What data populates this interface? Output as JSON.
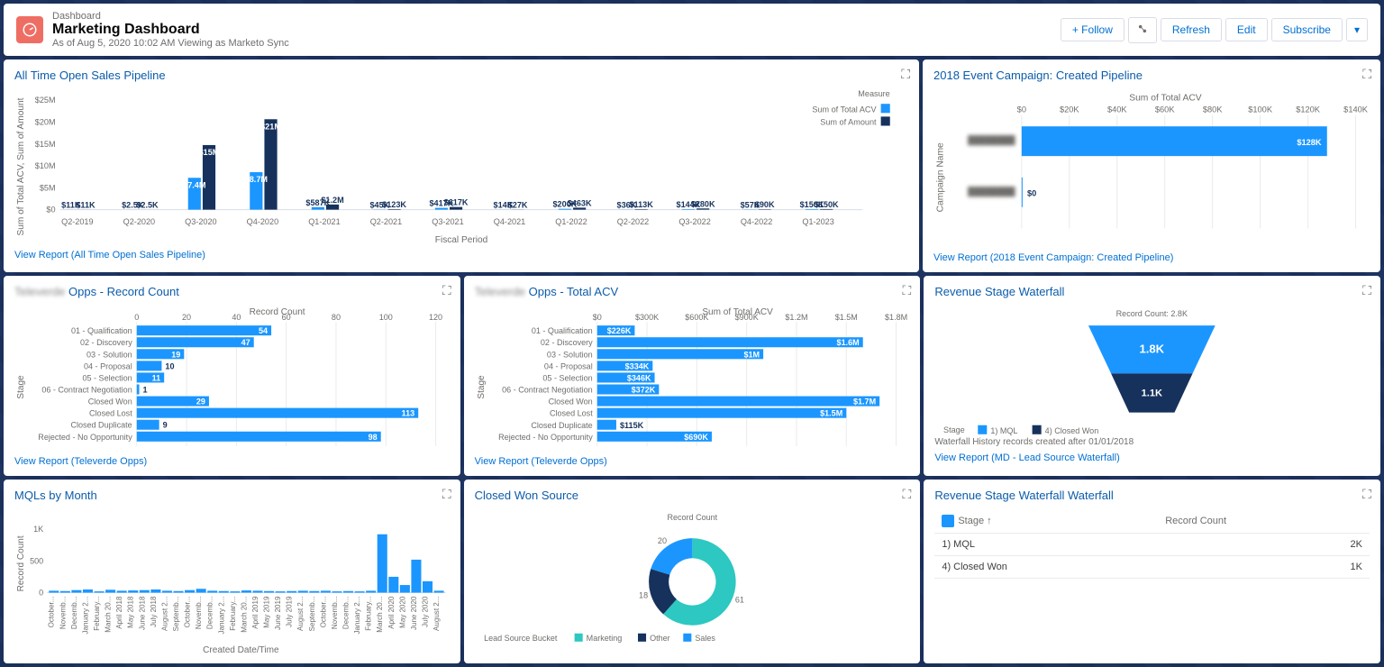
{
  "header": {
    "breadcrumb": "Dashboard",
    "title": "Marketing Dashboard",
    "subtitle": "As of Aug 5, 2020 10:02 AM Viewing as Marketo Sync",
    "follow": "+ Follow",
    "refresh": "Refresh",
    "edit": "Edit",
    "subscribe": "Subscribe"
  },
  "cards": {
    "pipeline": {
      "title": "All Time Open Sales Pipeline",
      "link": "View Report (All Time Open Sales Pipeline)",
      "legend_title": "Measure",
      "legend1": "Sum of Total ACV",
      "legend2": "Sum of Amount",
      "xlabel": "Fiscal Period",
      "ylabel": "Sum of Total ACV, Sum of Amount"
    },
    "event": {
      "title": "2018 Event Campaign: Created Pipeline",
      "link": "View Report (2018 Event Campaign: Created Pipeline)",
      "xlabel": "Sum of Total ACV",
      "ylabel": "Campaign Name"
    },
    "oppsCount": {
      "title": "Opps - Record Count",
      "title_prefix": "Telev...",
      "link": "View Report (Televerde Opps)",
      "xlabel": "Record Count",
      "ylabel": "Stage"
    },
    "oppsAcv": {
      "title": "Opps - Total ACV",
      "link": "View Report (Televerde Opps)",
      "xlabel": "Sum of Total ACV",
      "ylabel": "Stage"
    },
    "waterfall": {
      "title": "Revenue Stage Waterfall",
      "count_label": "Record Count: 2.8K",
      "note": "Waterfall History records created after 01/01/2018",
      "link": "View Report (MD - Lead Source Waterfall)",
      "stage_label": "Stage",
      "l1": "1) MQL",
      "l2": "4) Closed Won"
    },
    "mql": {
      "title": "MQLs by Month",
      "xlabel": "Created Date/Time",
      "ylabel": "Record Count"
    },
    "closedWon": {
      "title": "Closed Won Source",
      "center": "Record Count",
      "legend_label": "Lead Source Bucket",
      "l1": "Marketing",
      "l2": "Other",
      "l3": "Sales"
    },
    "waterfallTable": {
      "title": "Revenue Stage Waterfall Waterfall",
      "col1": "Stage",
      "col2": "Record Count",
      "r1": "1) MQL",
      "r1v": "2K",
      "r2": "4) Closed Won",
      "r2v": "1K"
    }
  },
  "chart_data": [
    {
      "id": "pipeline",
      "type": "bar",
      "title": "All Time Open Sales Pipeline",
      "xlabel": "Fiscal Period",
      "ylabel": "Sum of Total ACV, Sum of Amount",
      "ylim": [
        0,
        25000000
      ],
      "categories": [
        "Q2-2019",
        "Q2-2020",
        "Q3-2020",
        "Q4-2020",
        "Q1-2021",
        "Q2-2021",
        "Q3-2021",
        "Q4-2021",
        "Q1-2022",
        "Q2-2022",
        "Q3-2022",
        "Q4-2022",
        "Q1-2023"
      ],
      "series": [
        {
          "name": "Sum of Total ACV",
          "values": [
            11000,
            2500,
            7400000,
            8700000,
            587000,
            45000,
            417000,
            14000,
            200000,
            36000,
            144000,
            57000,
            150000
          ],
          "labels": [
            "$11K",
            "$2.5K",
            "$7.4M",
            "$8.7M",
            "$587K",
            "$45K",
            "$417K",
            "$14K",
            "$200K",
            "$36K",
            "$144K",
            "$57K",
            "$150K"
          ]
        },
        {
          "name": "Sum of Amount",
          "values": [
            11000,
            2500,
            15000000,
            21000000,
            1200000,
            123000,
            617000,
            27000,
            463000,
            113000,
            280000,
            90000,
            150000
          ],
          "labels": [
            "$11K",
            "$2.5K",
            "$15M",
            "$21M",
            "$1.2M",
            "$123K",
            "$617K",
            "$27K",
            "$463K",
            "$113K",
            "$280K",
            "$90K",
            "$150K"
          ]
        }
      ]
    },
    {
      "id": "event",
      "type": "bar",
      "orientation": "horizontal",
      "title": "2018 Event Campaign: Created Pipeline",
      "xlabel": "Sum of Total ACV",
      "ylabel": "Campaign Name",
      "xlim": [
        0,
        140000
      ],
      "xticks": [
        "$0",
        "$20K",
        "$40K",
        "$60K",
        "$80K",
        "$100K",
        "$120K",
        "$140K"
      ],
      "categories": [
        "(redacted campaign 1)",
        "(redacted campaign 2)"
      ],
      "values": [
        128000,
        0
      ],
      "labels": [
        "$128K",
        "$0"
      ]
    },
    {
      "id": "oppsCount",
      "type": "bar",
      "orientation": "horizontal",
      "title": "Opps - Record Count",
      "xlabel": "Record Count",
      "xlim": [
        0,
        120
      ],
      "xticks": [
        0,
        20,
        40,
        60,
        80,
        100,
        120
      ],
      "categories": [
        "01 - Qualification",
        "02 - Discovery",
        "03 - Solution",
        "04 - Proposal",
        "05 - Selection",
        "06 - Contract Negotiation",
        "Closed Won",
        "Closed Lost",
        "Closed Duplicate",
        "Rejected - No Opportunity"
      ],
      "values": [
        54,
        47,
        19,
        10,
        11,
        1,
        29,
        113,
        9,
        98
      ]
    },
    {
      "id": "oppsAcv",
      "type": "bar",
      "orientation": "horizontal",
      "title": "Opps - Total ACV",
      "xlabel": "Sum of Total ACV",
      "xlim": [
        0,
        1800000
      ],
      "xticks": [
        "$0",
        "$300K",
        "$600K",
        "$900K",
        "$1.2M",
        "$1.5M",
        "$1.8M"
      ],
      "categories": [
        "01 - Qualification",
        "02 - Discovery",
        "03 - Solution",
        "04 - Proposal",
        "05 - Selection",
        "06 - Contract Negotiation",
        "Closed Won",
        "Closed Lost",
        "Closed Duplicate",
        "Rejected - No Opportunity"
      ],
      "values": [
        226000,
        1600000,
        1000000,
        334000,
        346000,
        372000,
        1700000,
        1500000,
        115000,
        690000
      ],
      "labels": [
        "$226K",
        "$1.6M",
        "$1M",
        "$334K",
        "$346K",
        "$372K",
        "$1.7M",
        "$1.5M",
        "$115K",
        "$690K"
      ]
    },
    {
      "id": "waterfallFunnel",
      "type": "funnel",
      "title": "Revenue Stage Waterfall",
      "total": 2800,
      "stages": [
        {
          "name": "1) MQL",
          "value": 1800,
          "label": "1.8K"
        },
        {
          "name": "4) Closed Won",
          "value": 1100,
          "label": "1.1K"
        }
      ]
    },
    {
      "id": "mql",
      "type": "bar",
      "title": "MQLs by Month",
      "xlabel": "Created Date/Time",
      "ylabel": "Record Count",
      "ylim": [
        0,
        1000
      ],
      "yticks": [
        0,
        500,
        "1K"
      ],
      "categories": [
        "October...",
        "Novemb...",
        "Decemb...",
        "January 2...",
        "February...",
        "March 20...",
        "April 2018",
        "May 2018",
        "June 2018",
        "July 2018",
        "August 2...",
        "Septemb...",
        "October...",
        "Novemb...",
        "Decemb...",
        "January 2...",
        "February...",
        "March 20...",
        "April 2019",
        "May 2019",
        "June 2019",
        "July 2019",
        "August 2...",
        "Septemb...",
        "October...",
        "Novemb...",
        "Decemb...",
        "January 2...",
        "February...",
        "March 20...",
        "April 2020",
        "May 2020",
        "June 2020",
        "July 2020",
        "August 2..."
      ],
      "values": [
        30,
        25,
        40,
        50,
        20,
        45,
        30,
        35,
        40,
        50,
        30,
        25,
        40,
        60,
        30,
        25,
        20,
        35,
        30,
        25,
        20,
        25,
        30,
        25,
        30,
        20,
        25,
        20,
        30,
        920,
        250,
        120,
        520,
        180,
        30
      ]
    },
    {
      "id": "closedWon",
      "type": "pie",
      "title": "Closed Won Source",
      "series": [
        {
          "name": "Marketing",
          "value": 61
        },
        {
          "name": "Other",
          "value": 18
        },
        {
          "name": "Sales",
          "value": 20
        }
      ]
    },
    {
      "id": "waterfallTable",
      "type": "table",
      "title": "Revenue Stage Waterfall Waterfall",
      "columns": [
        "Stage",
        "Record Count"
      ],
      "rows": [
        [
          "1) MQL",
          "2K"
        ],
        [
          "4) Closed Won",
          "1K"
        ]
      ]
    }
  ]
}
